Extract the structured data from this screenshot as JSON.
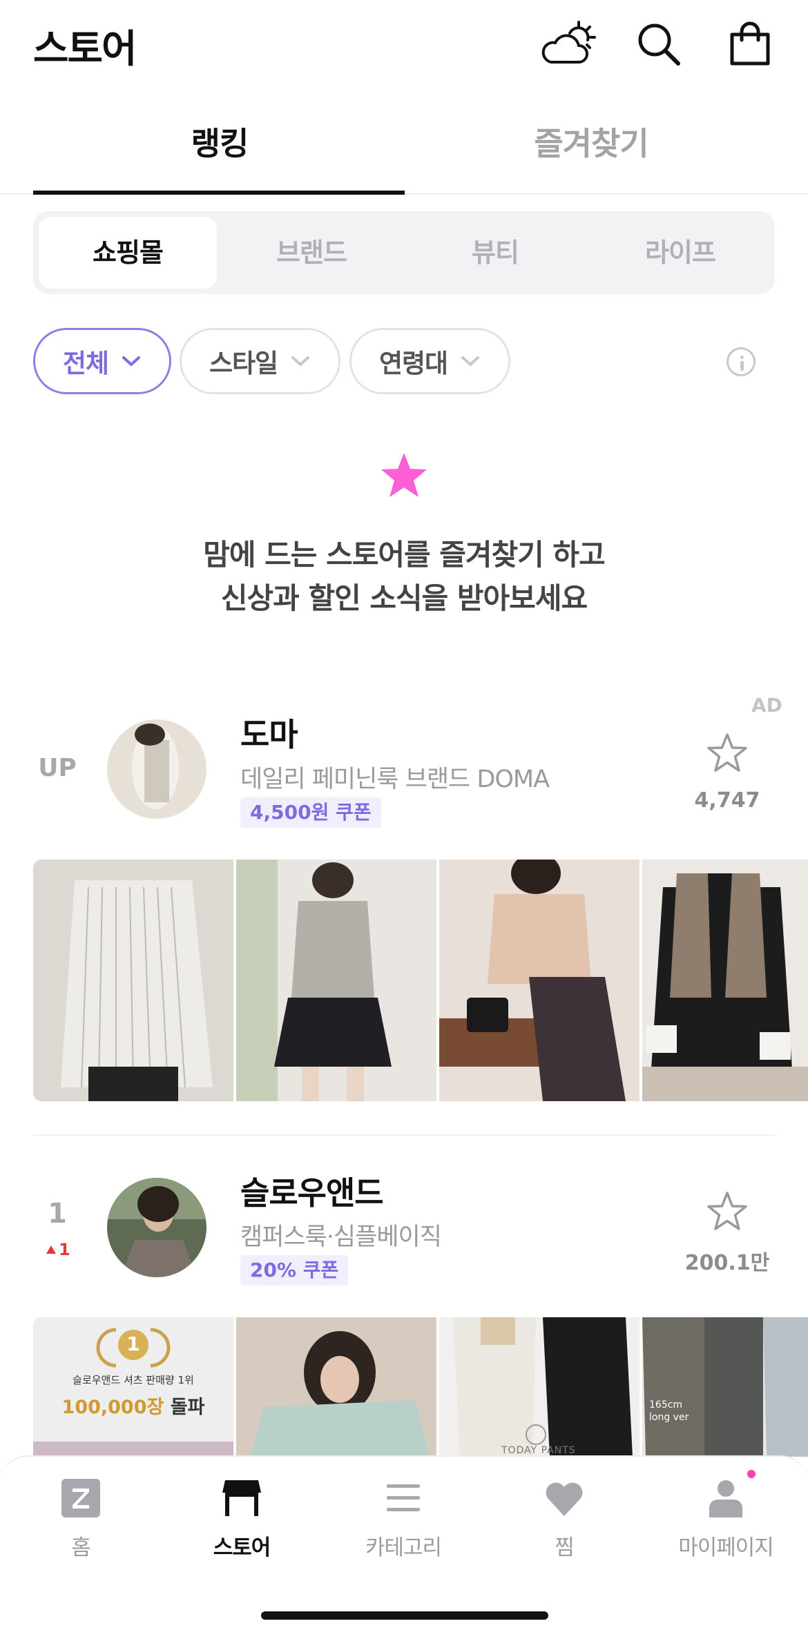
{
  "header": {
    "title": "스토어"
  },
  "top_tabs": [
    {
      "label": "랭킹",
      "active": true
    },
    {
      "label": "즐겨찾기",
      "active": false
    }
  ],
  "segments": [
    {
      "label": "쇼핑몰",
      "active": true
    },
    {
      "label": "브랜드",
      "active": false
    },
    {
      "label": "뷰티",
      "active": false
    },
    {
      "label": "라이프",
      "active": false
    }
  ],
  "filters": [
    {
      "label": "전체",
      "active": true
    },
    {
      "label": "스타일",
      "active": false
    },
    {
      "label": "연령대",
      "active": false
    }
  ],
  "promo": {
    "line1": "맘에 드는 스토어를 즐겨찾기 하고",
    "line2": "신상과 할인 소식을 받아보세요"
  },
  "stores": [
    {
      "ad_label": "AD",
      "rank": "UP",
      "name": "도마",
      "description": "데일리 페미닌룩 브랜드 DOMA",
      "coupon": "4,500원 쿠폰",
      "favorites": "4,747"
    },
    {
      "rank": "1",
      "rank_change": "1",
      "name": "슬로우앤드",
      "description": "캠퍼스룩·심플베이직",
      "coupon": "20% 쿠폰",
      "favorites": "200.1만",
      "thumb_texts": {
        "badge_number": "1",
        "badge_caption": "슬로우앤드 셔츠 판매량 1위",
        "headline_number": "100,000장",
        "headline_suffix": " 돌파",
        "size_note_1": "165cm",
        "size_note_2": "long ver",
        "brand_mark": "TODAY PANTS"
      }
    }
  ],
  "bottom_nav": [
    {
      "label": "홈",
      "icon": "z-home-icon",
      "active": false
    },
    {
      "label": "스토어",
      "icon": "store-icon",
      "active": true
    },
    {
      "label": "카테고리",
      "icon": "menu-icon",
      "active": false
    },
    {
      "label": "찜",
      "icon": "heart-icon",
      "active": false
    },
    {
      "label": "마이페이지",
      "icon": "person-icon",
      "active": false
    }
  ],
  "colors": {
    "accent": "#7b6ce0",
    "star_pink": "#ff5fd6",
    "rank_up": "#e03b3b"
  }
}
